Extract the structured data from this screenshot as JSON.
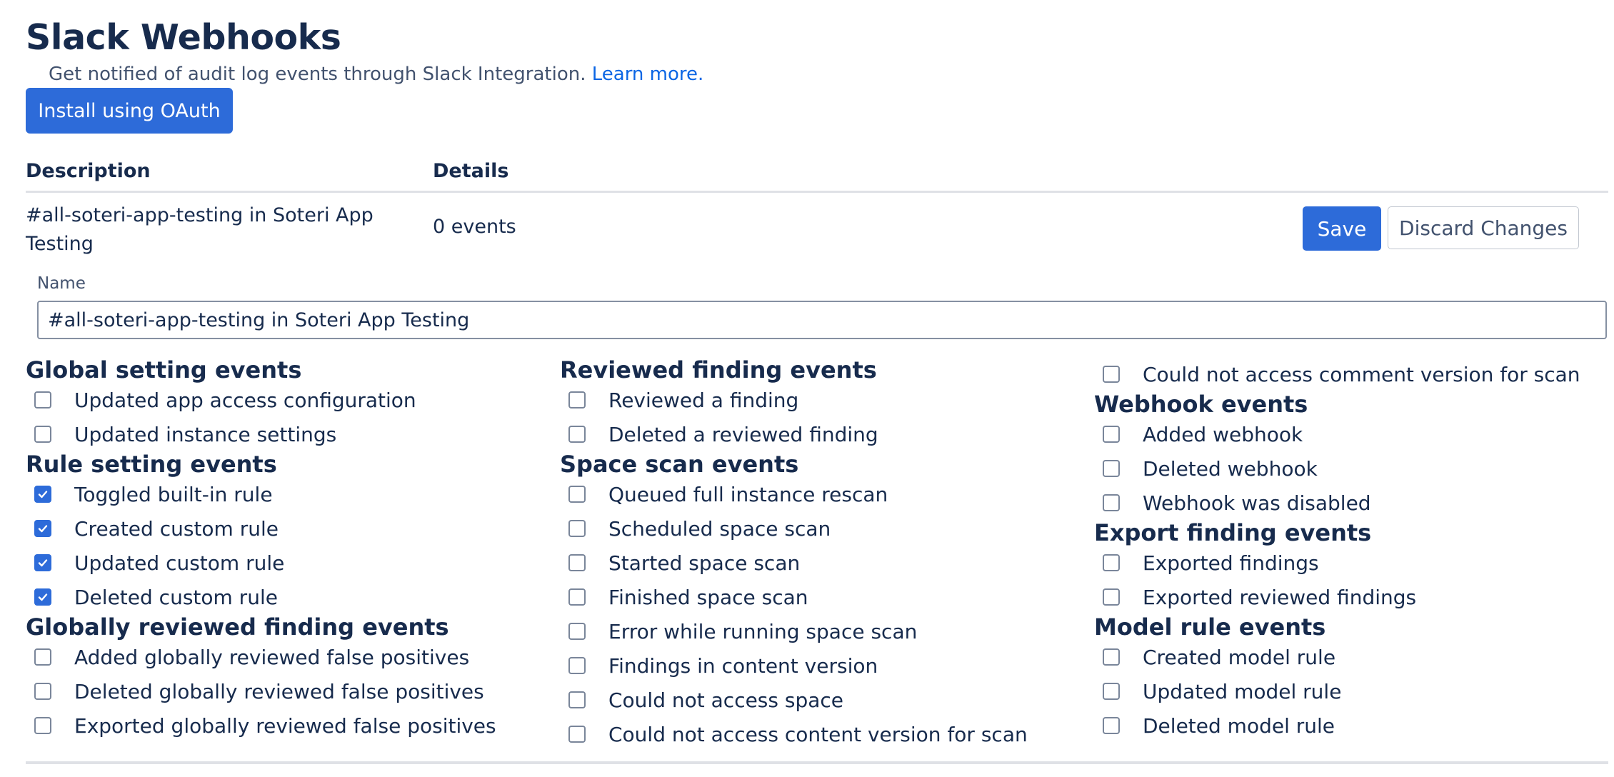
{
  "header": {
    "title": "Slack Webhooks",
    "subtitle": "Get notified of audit log events through Slack Integration.",
    "learn_more": "Learn more.",
    "install_button": "Install using OAuth"
  },
  "table": {
    "col_description": "Description",
    "col_details": "Details",
    "row": {
      "description": "#all-soteri-app-testing in Soteri App Testing",
      "details": "0 events",
      "save_label": "Save",
      "discard_label": "Discard Changes"
    }
  },
  "name_field": {
    "label": "Name",
    "value": "#all-soteri-app-testing in Soteri App Testing"
  },
  "columns": [
    {
      "groups": [
        {
          "title": "Global setting events",
          "items": [
            {
              "label": "Updated app access configuration",
              "checked": false
            },
            {
              "label": "Updated instance settings",
              "checked": false
            }
          ]
        },
        {
          "title": "Rule setting events",
          "items": [
            {
              "label": "Toggled built-in rule",
              "checked": true
            },
            {
              "label": "Created custom rule",
              "checked": true
            },
            {
              "label": "Updated custom rule",
              "checked": true
            },
            {
              "label": "Deleted custom rule",
              "checked": true
            }
          ]
        },
        {
          "title": "Globally reviewed finding events",
          "items": [
            {
              "label": "Added globally reviewed false positives",
              "checked": false
            },
            {
              "label": "Deleted globally reviewed false positives",
              "checked": false
            },
            {
              "label": "Exported globally reviewed false positives",
              "checked": false
            }
          ]
        }
      ]
    },
    {
      "groups": [
        {
          "title": "Reviewed finding events",
          "items": [
            {
              "label": "Reviewed a finding",
              "checked": false
            },
            {
              "label": "Deleted a reviewed finding",
              "checked": false
            }
          ]
        },
        {
          "title": "Space scan events",
          "items": [
            {
              "label": "Queued full instance rescan",
              "checked": false
            },
            {
              "label": "Scheduled space scan",
              "checked": false
            },
            {
              "label": "Started space scan",
              "checked": false
            },
            {
              "label": "Finished space scan",
              "checked": false
            },
            {
              "label": "Error while running space scan",
              "checked": false
            },
            {
              "label": "Findings in content version",
              "checked": false
            },
            {
              "label": "Could not access space",
              "checked": false
            },
            {
              "label": "Could not access content version for scan",
              "checked": false
            }
          ]
        }
      ]
    },
    {
      "groups": [
        {
          "title": "",
          "items": [
            {
              "label": "Could not access comment version for scan",
              "checked": false
            }
          ]
        },
        {
          "title": "Webhook events",
          "items": [
            {
              "label": "Added webhook",
              "checked": false
            },
            {
              "label": "Deleted webhook",
              "checked": false
            },
            {
              "label": "Webhook was disabled",
              "checked": false
            }
          ]
        },
        {
          "title": "Export finding events",
          "items": [
            {
              "label": "Exported findings",
              "checked": false
            },
            {
              "label": "Exported reviewed findings",
              "checked": false
            }
          ]
        },
        {
          "title": "Model rule events",
          "items": [
            {
              "label": "Created model rule",
              "checked": false
            },
            {
              "label": "Updated model rule",
              "checked": false
            },
            {
              "label": "Deleted model rule",
              "checked": false
            }
          ]
        }
      ]
    }
  ],
  "colors": {
    "primary": "#2d6bd9",
    "link": "#0c66e4",
    "text": "#172b4d"
  }
}
